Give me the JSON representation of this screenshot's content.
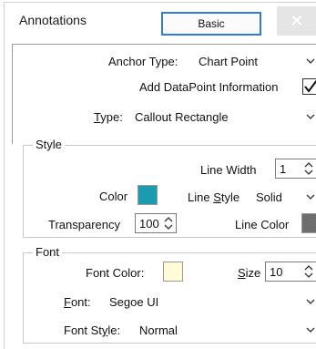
{
  "tabs": {
    "annotations": "Annotations",
    "basic": "Basic"
  },
  "close_symbol": "✕",
  "anchor": {
    "label": "Anchor Type:",
    "value": "Chart Point"
  },
  "add_datapoint": {
    "label": "Add DataPoint Information",
    "checked": true
  },
  "type": {
    "label": "Type:",
    "value": "Callout Rectangle"
  },
  "style": {
    "title": "Style",
    "line_width_label": "Line Width",
    "line_width_value": "1",
    "color_label": "Color",
    "color_value": "#1a9bb0",
    "line_style_label": "Line Style",
    "line_style_value": "Solid",
    "transparency_label": "Transparency",
    "transparency_value": "100",
    "line_color_label": "Line Color",
    "line_color_value": "#6e6e6e"
  },
  "font": {
    "title": "Font",
    "font_color_label": "Font Color:",
    "font_color_value": "#fffbd8",
    "size_label": "Size",
    "size_value": "10",
    "font_label": "Font:",
    "font_value": "Segoe UI",
    "font_style_label": "Font Style:",
    "font_style_value": "Normal"
  }
}
